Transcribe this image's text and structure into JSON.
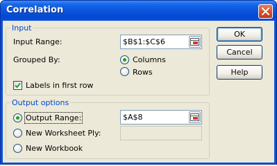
{
  "window": {
    "title": "Correlation"
  },
  "input_group": {
    "legend": "Input",
    "input_range_label": "Input Range:",
    "input_range_value": "$B$1:$C$6",
    "grouped_by_label": "Grouped By:",
    "columns_label": "Columns",
    "rows_label": "Rows",
    "grouped_by_selected": "Columns",
    "labels_first_row_label": "Labels in first row",
    "labels_first_row_checked": true
  },
  "output_group": {
    "legend": "Output options",
    "output_range_label": "Output Range:",
    "output_range_value": "$A$8",
    "new_ply_label": "New Worksheet Ply:",
    "new_ply_value": "",
    "new_workbook_label": "New Workbook",
    "selected": "Output Range"
  },
  "buttons": {
    "ok": "OK",
    "cancel": "Cancel",
    "help": "Help"
  },
  "colors": {
    "titlebar": "#0a55dd",
    "client": "#ece9d8",
    "group_legend": "#0046d5"
  }
}
